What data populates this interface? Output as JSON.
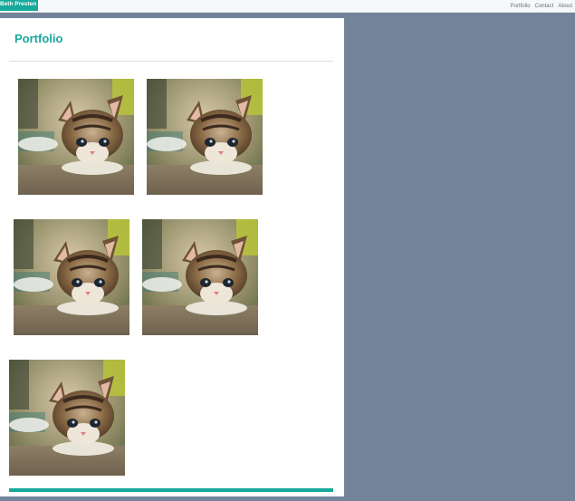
{
  "navbar": {
    "brand": "Beth Presten",
    "links": [
      "Portfolio",
      "Contact",
      "About"
    ]
  },
  "page": {
    "title": "Portfolio"
  },
  "gallery": {
    "items": [
      {
        "alt": "kitten photo"
      },
      {
        "alt": "kitten photo"
      },
      {
        "alt": "kitten photo"
      },
      {
        "alt": "kitten photo"
      },
      {
        "alt": "kitten photo"
      }
    ]
  },
  "colors": {
    "accent": "#17a99b",
    "background": "#738399",
    "panel": "#ffffff"
  }
}
